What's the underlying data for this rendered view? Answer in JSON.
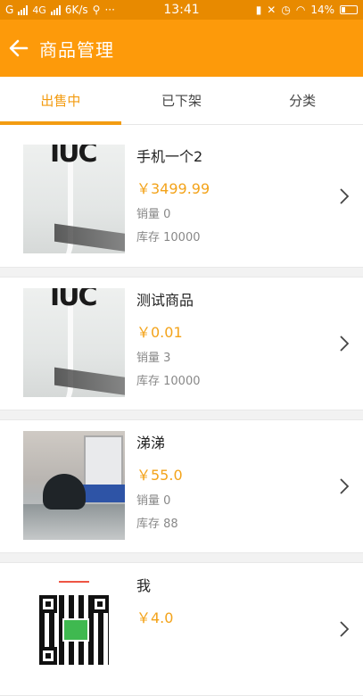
{
  "status_bar": {
    "left_text": "G",
    "network": "4G",
    "speed": "6K/s",
    "dots": "···",
    "time": "13:41",
    "battery": "14%"
  },
  "header": {
    "title": "商品管理"
  },
  "tabs": [
    {
      "label": "出售中",
      "active": true
    },
    {
      "label": "已下架",
      "active": false
    },
    {
      "label": "分类",
      "active": false
    }
  ],
  "products": [
    {
      "name": "手机一个2",
      "price": "￥3499.99",
      "sales": "销量 0",
      "stock": "库存 10000"
    },
    {
      "name": "测试商品",
      "price": "￥0.01",
      "sales": "销量 3",
      "stock": "库存 10000"
    },
    {
      "name": "涕涕",
      "price": "￥55.0",
      "sales": "销量 0",
      "stock": "库存 88"
    },
    {
      "name": "我",
      "price": "￥4.0",
      "sales": "",
      "stock": ""
    }
  ],
  "thumbnail_text": {
    "sign_letters": "IUC"
  },
  "colors": {
    "header": "#fd9a0a",
    "status_bar": "#e88a00",
    "accent": "#f39c12",
    "price": "#f3a31a"
  }
}
